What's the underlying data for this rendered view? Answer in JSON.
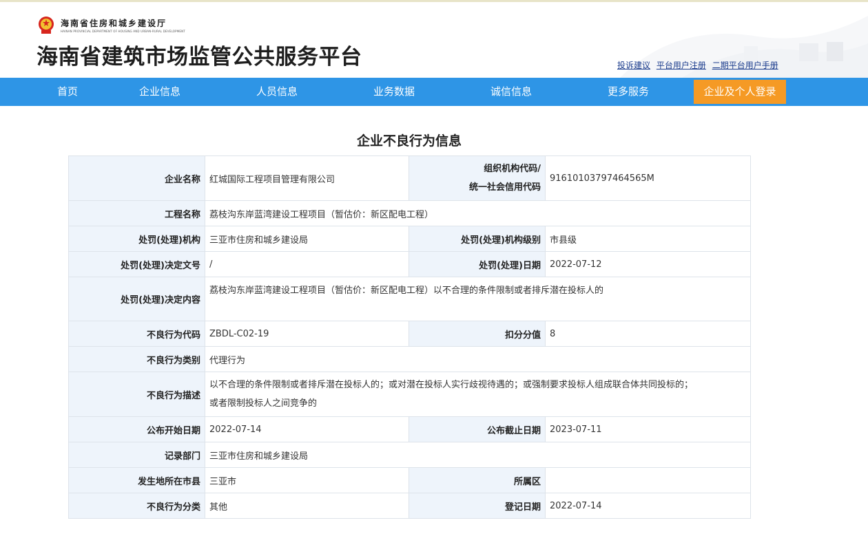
{
  "header": {
    "dept_name": "海南省住房和城乡建设厅",
    "dept_name_en": "HAINAN PROVINCIAL DEPARTMENT OF HOUSING AND URBAN-RURAL DEVELOPMENT",
    "site_title": "海南省建筑市场监管公共服务平台",
    "links": [
      "投诉建议",
      "平台用户注册",
      "二期平台用户手册"
    ]
  },
  "nav": {
    "items": [
      "首页",
      "企业信息",
      "人员信息",
      "业务数据",
      "诚信信息",
      "更多服务"
    ],
    "login": "企业及个人登录"
  },
  "page": {
    "title": "企业不良行为信息"
  },
  "record": {
    "labels": {
      "company_name": "企业名称",
      "org_code_line1": "组织机构代码/",
      "org_code_line2": "统一社会信用代码",
      "project_name": "工程名称",
      "punish_org": "处罚(处理)机构",
      "punish_org_level": "处罚(处理)机构级别",
      "decision_no": "处罚(处理)决定文号",
      "punish_date": "处罚(处理)日期",
      "decision_content": "处罚(处理)决定内容",
      "behavior_code": "不良行为代码",
      "deduct_points": "扣分分值",
      "behavior_type": "不良行为类别",
      "behavior_desc": "不良行为描述",
      "publish_start": "公布开始日期",
      "publish_end": "公布截止日期",
      "record_dept": "记录部门",
      "city": "发生地所在市县",
      "district": "所属区",
      "behavior_class": "不良行为分类",
      "register_date": "登记日期"
    },
    "values": {
      "company_name": "红城国际工程项目管理有限公司",
      "org_code": "91610103797464565M",
      "project_name": "荔枝沟东岸蓝湾建设工程项目（暂估价：新区配电工程）",
      "punish_org": "三亚市住房和城乡建设局",
      "punish_org_level": "市县级",
      "decision_no": "/",
      "punish_date": "2022-07-12",
      "decision_content": "荔枝沟东岸蓝湾建设工程项目（暂估价：新区配电工程）以不合理的条件限制或者排斥潜在投标人的",
      "behavior_code": "ZBDL-C02-19",
      "deduct_points": "8",
      "behavior_type": "代理行为",
      "behavior_desc_line1": "以不合理的条件限制或者排斥潜在投标人的；或对潜在投标人实行歧视待遇的；或强制要求投标人组成联合体共同投标的；",
      "behavior_desc_line2": "或者限制投标人之间竞争的",
      "publish_start": "2022-07-14",
      "publish_end": "2023-07-11",
      "record_dept": "三亚市住房和城乡建设局",
      "city": "三亚市",
      "district": "",
      "behavior_class": "其他",
      "register_date": "2022-07-14"
    }
  },
  "colors": {
    "nav_bg": "#2e95e6",
    "login_bg": "#f59a25",
    "label_bg": "#eef4fb",
    "link": "#1a3b8c"
  }
}
